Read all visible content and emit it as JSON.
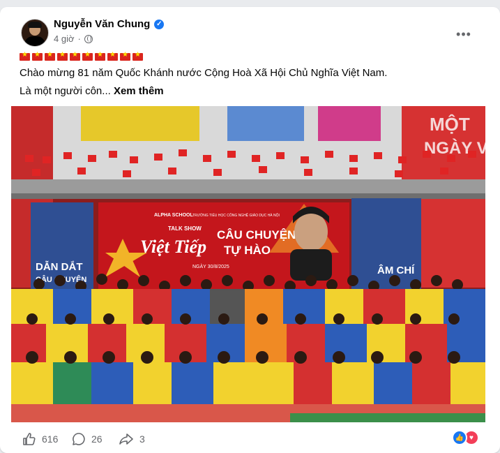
{
  "post": {
    "author": "Nguyễn Văn Chung",
    "time": "4 giờ",
    "flags_count": 10,
    "line1": "Chào mừng 81 năm Quốc Khánh nước Cộng Hoà Xã Hội Chủ Nghĩa Việt Nam.",
    "line2_prefix": "Là một người côn...",
    "see_more": "Xem thêm"
  },
  "photo": {
    "banner_school": "ALPHA SCHOOL",
    "banner_school2": "TRƯỜNG TIỂU HỌC CÔNG NGHỆ GIÁO DỤC HÀ NỘI",
    "talk_show": "TALK SHOW",
    "title1": "Việt Tiếp",
    "title2": "CÂU CHUYỆN",
    "title3": "TỰ HÀO",
    "date": "NGÀY 30/8/2025",
    "left_panel": "DẪN DẮT",
    "left_panel2": "CÂU CHUYỆN",
    "right_panel": "ÂM CHÍ",
    "top_right": "MỘT",
    "top_right2": "NGÀY V"
  },
  "actions": {
    "likes": "616",
    "comments": "26",
    "shares": "3"
  },
  "colors": {
    "brand_blue": "#1877f2",
    "reaction_red": "#f33e58"
  }
}
